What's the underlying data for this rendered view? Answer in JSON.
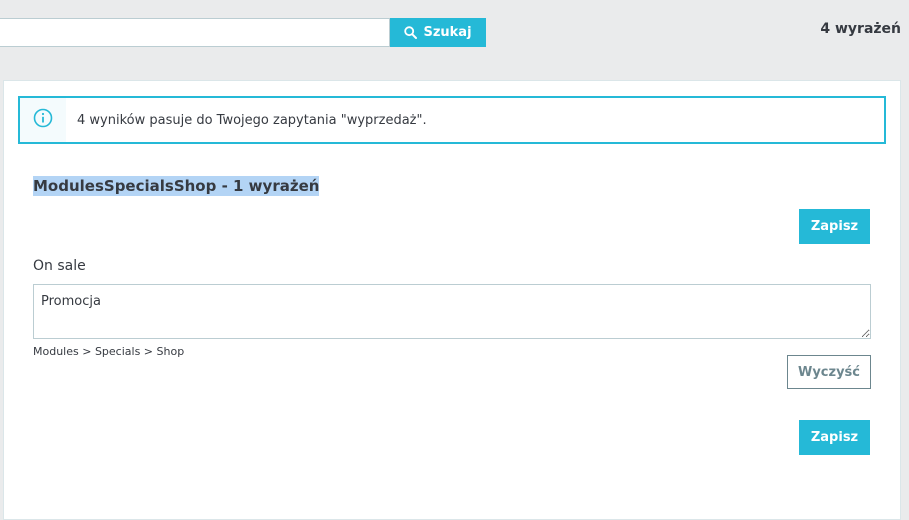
{
  "search": {
    "value": "",
    "placeholder": "",
    "button_label": "Szukaj",
    "icon": "search-icon"
  },
  "header": {
    "count_label": "4 wyrażeń"
  },
  "alert": {
    "icon": "info-icon",
    "text": "4 wyników pasuje do Twojego zapytania \"wyprzedaż\"."
  },
  "section": {
    "title": "ModulesSpecialsShop - 1 wyrażeń",
    "save_label": "Zapisz",
    "field": {
      "label": "On sale",
      "value": "Promocja",
      "breadcrumb": "Modules > Specials > Shop",
      "reset_label": "Wyczyść"
    },
    "save_bottom_label": "Zapisz"
  },
  "colors": {
    "primary": "#25b9d7",
    "text": "#363a41",
    "background": "#eaebec",
    "selection": "#b3d4f5",
    "outline_button": "#6c868e"
  }
}
